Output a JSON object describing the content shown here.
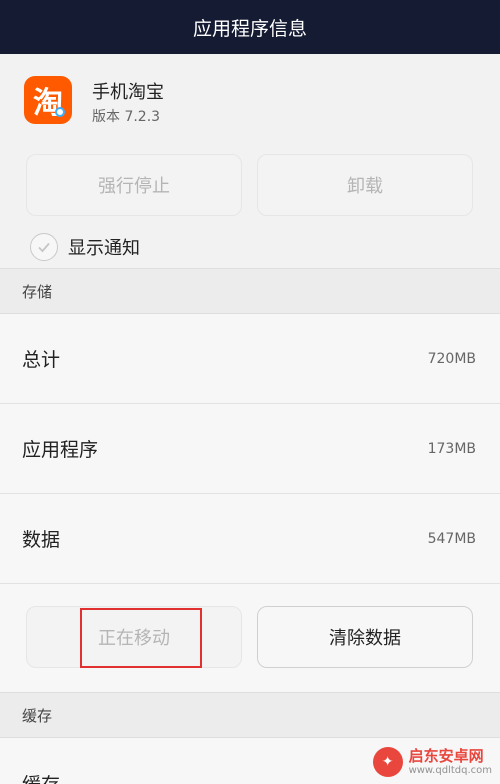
{
  "titlebar": {
    "title": "应用程序信息"
  },
  "app": {
    "icon_glyph": "淘",
    "name": "手机淘宝",
    "version": "版本 7.2.3",
    "icon_color": "#ff5a00"
  },
  "actions": {
    "force_stop_label": "强行停止",
    "uninstall_label": "卸载"
  },
  "notification": {
    "label": "显示通知",
    "checked": false
  },
  "storage": {
    "header": "存储",
    "rows": [
      {
        "label": "总计",
        "value": "720MB"
      },
      {
        "label": "应用程序",
        "value": "173MB"
      },
      {
        "label": "数据",
        "value": "547MB"
      }
    ],
    "moving_label": "正在移动",
    "clear_data_label": "清除数据"
  },
  "cache": {
    "header": "缓存",
    "row_label": "缓存"
  },
  "watermark": {
    "title": "启东安卓网",
    "url": "www.qdltdq.com"
  }
}
